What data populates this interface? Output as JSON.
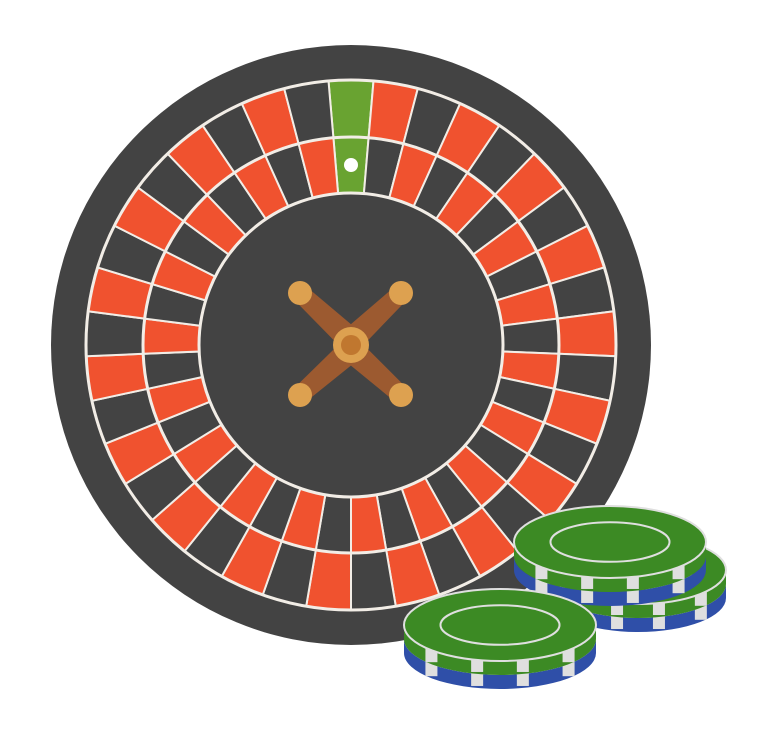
{
  "illustration": {
    "subject": "roulette-wheel-with-casino-chips",
    "wheel": {
      "pocket_count": 37,
      "pocket_colors": {
        "zero": "#69a331",
        "red": "#f0522f",
        "black": "#434343"
      },
      "rim_color": "#434343",
      "separator_color": "#f2ede6",
      "ball_color": "#ffffff"
    },
    "turret": {
      "arm_color": "#9c5a30",
      "knob_color": "#dda150",
      "center_color": "#c0772f"
    },
    "chips": {
      "stack_count": 3,
      "top_color": "#3c8a24",
      "edge_colors": [
        "#3c8a24",
        "#2f4fa8",
        "#dfdfdf"
      ]
    }
  }
}
